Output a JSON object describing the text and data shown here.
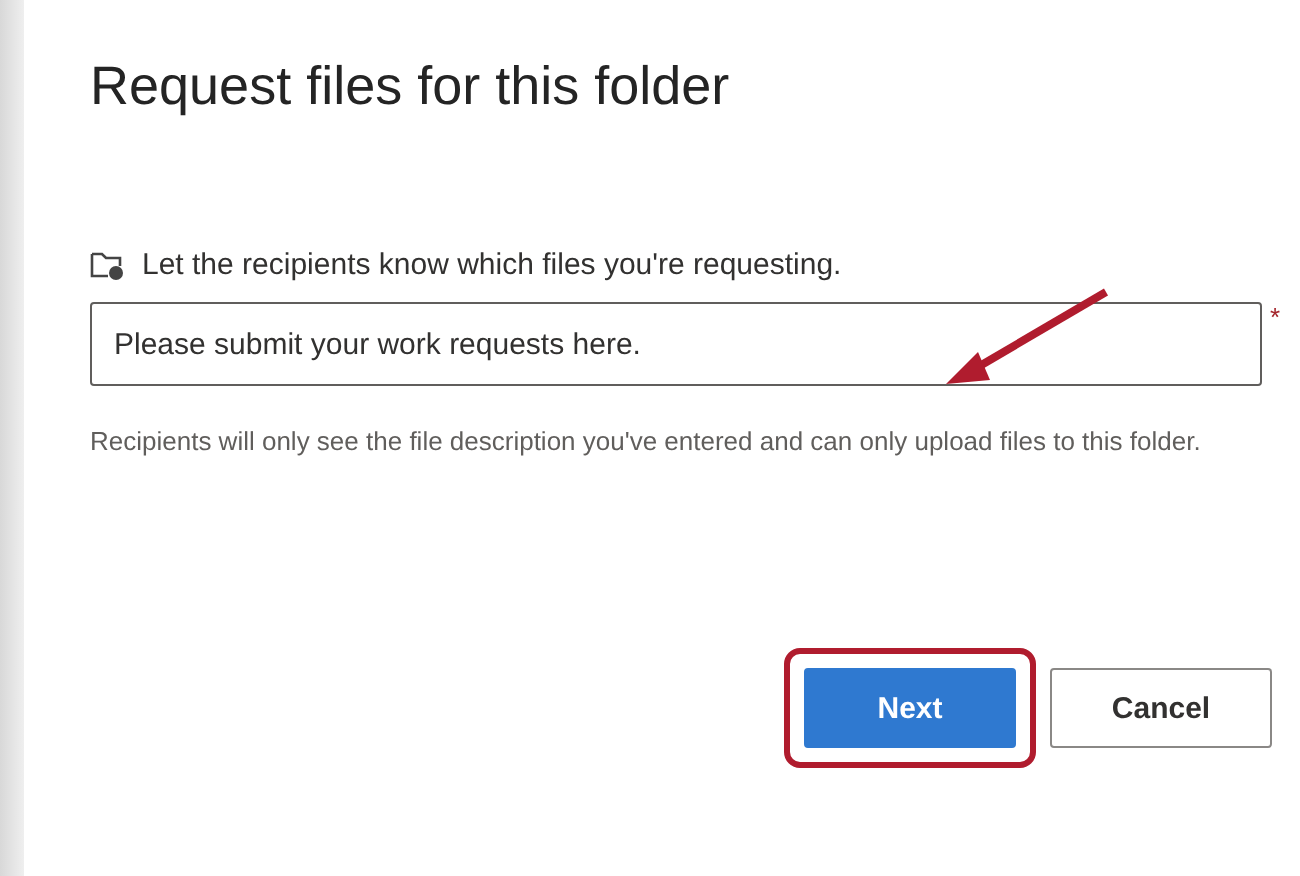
{
  "dialog": {
    "title": "Request files for this folder",
    "prompt": "Let the recipients know which files you're requesting.",
    "field": {
      "value": "Please submit your work requests here.",
      "required": true,
      "required_mark": "*"
    },
    "helper": "Recipients will only see the file description you've entered and can only upload files to this folder.",
    "buttons": [
      {
        "label": "Next",
        "kind": "primary",
        "highlighted": true
      },
      {
        "label": "Cancel",
        "kind": "secondary",
        "highlighted": false
      }
    ]
  }
}
